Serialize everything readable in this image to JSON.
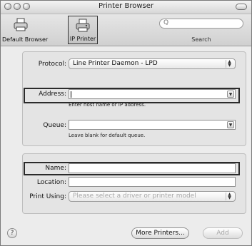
{
  "window": {
    "title": "Printer Browser"
  },
  "toolbar": {
    "default_browser_label": "Default Browser",
    "ip_printer_label": "IP Printer",
    "search_label": "Search",
    "search_placeholder": ""
  },
  "form": {
    "protocol_label": "Protocol:",
    "protocol_value": "Line Printer Daemon - LPD",
    "address_label": "Address:",
    "address_value": "",
    "address_hint": "Enter host name or IP address.",
    "queue_label": "Queue:",
    "queue_value": "",
    "queue_hint": "Leave blank for default queue."
  },
  "details": {
    "name_label": "Name:",
    "name_value": "",
    "location_label": "Location:",
    "location_value": "",
    "print_using_label": "Print Using:",
    "print_using_value": "Please select a driver or printer model"
  },
  "footer": {
    "help_glyph": "?",
    "more_printers_label": "More Printers...",
    "add_label": "Add"
  },
  "icons": [
    "close-light-icon",
    "minimize-light-icon",
    "zoom-light-icon",
    "toolbar-toggle-icon",
    "default-printer-icon",
    "ip-printer-icon",
    "search-icon",
    "popup-arrows-icon",
    "combo-arrow-icon",
    "help-icon"
  ]
}
